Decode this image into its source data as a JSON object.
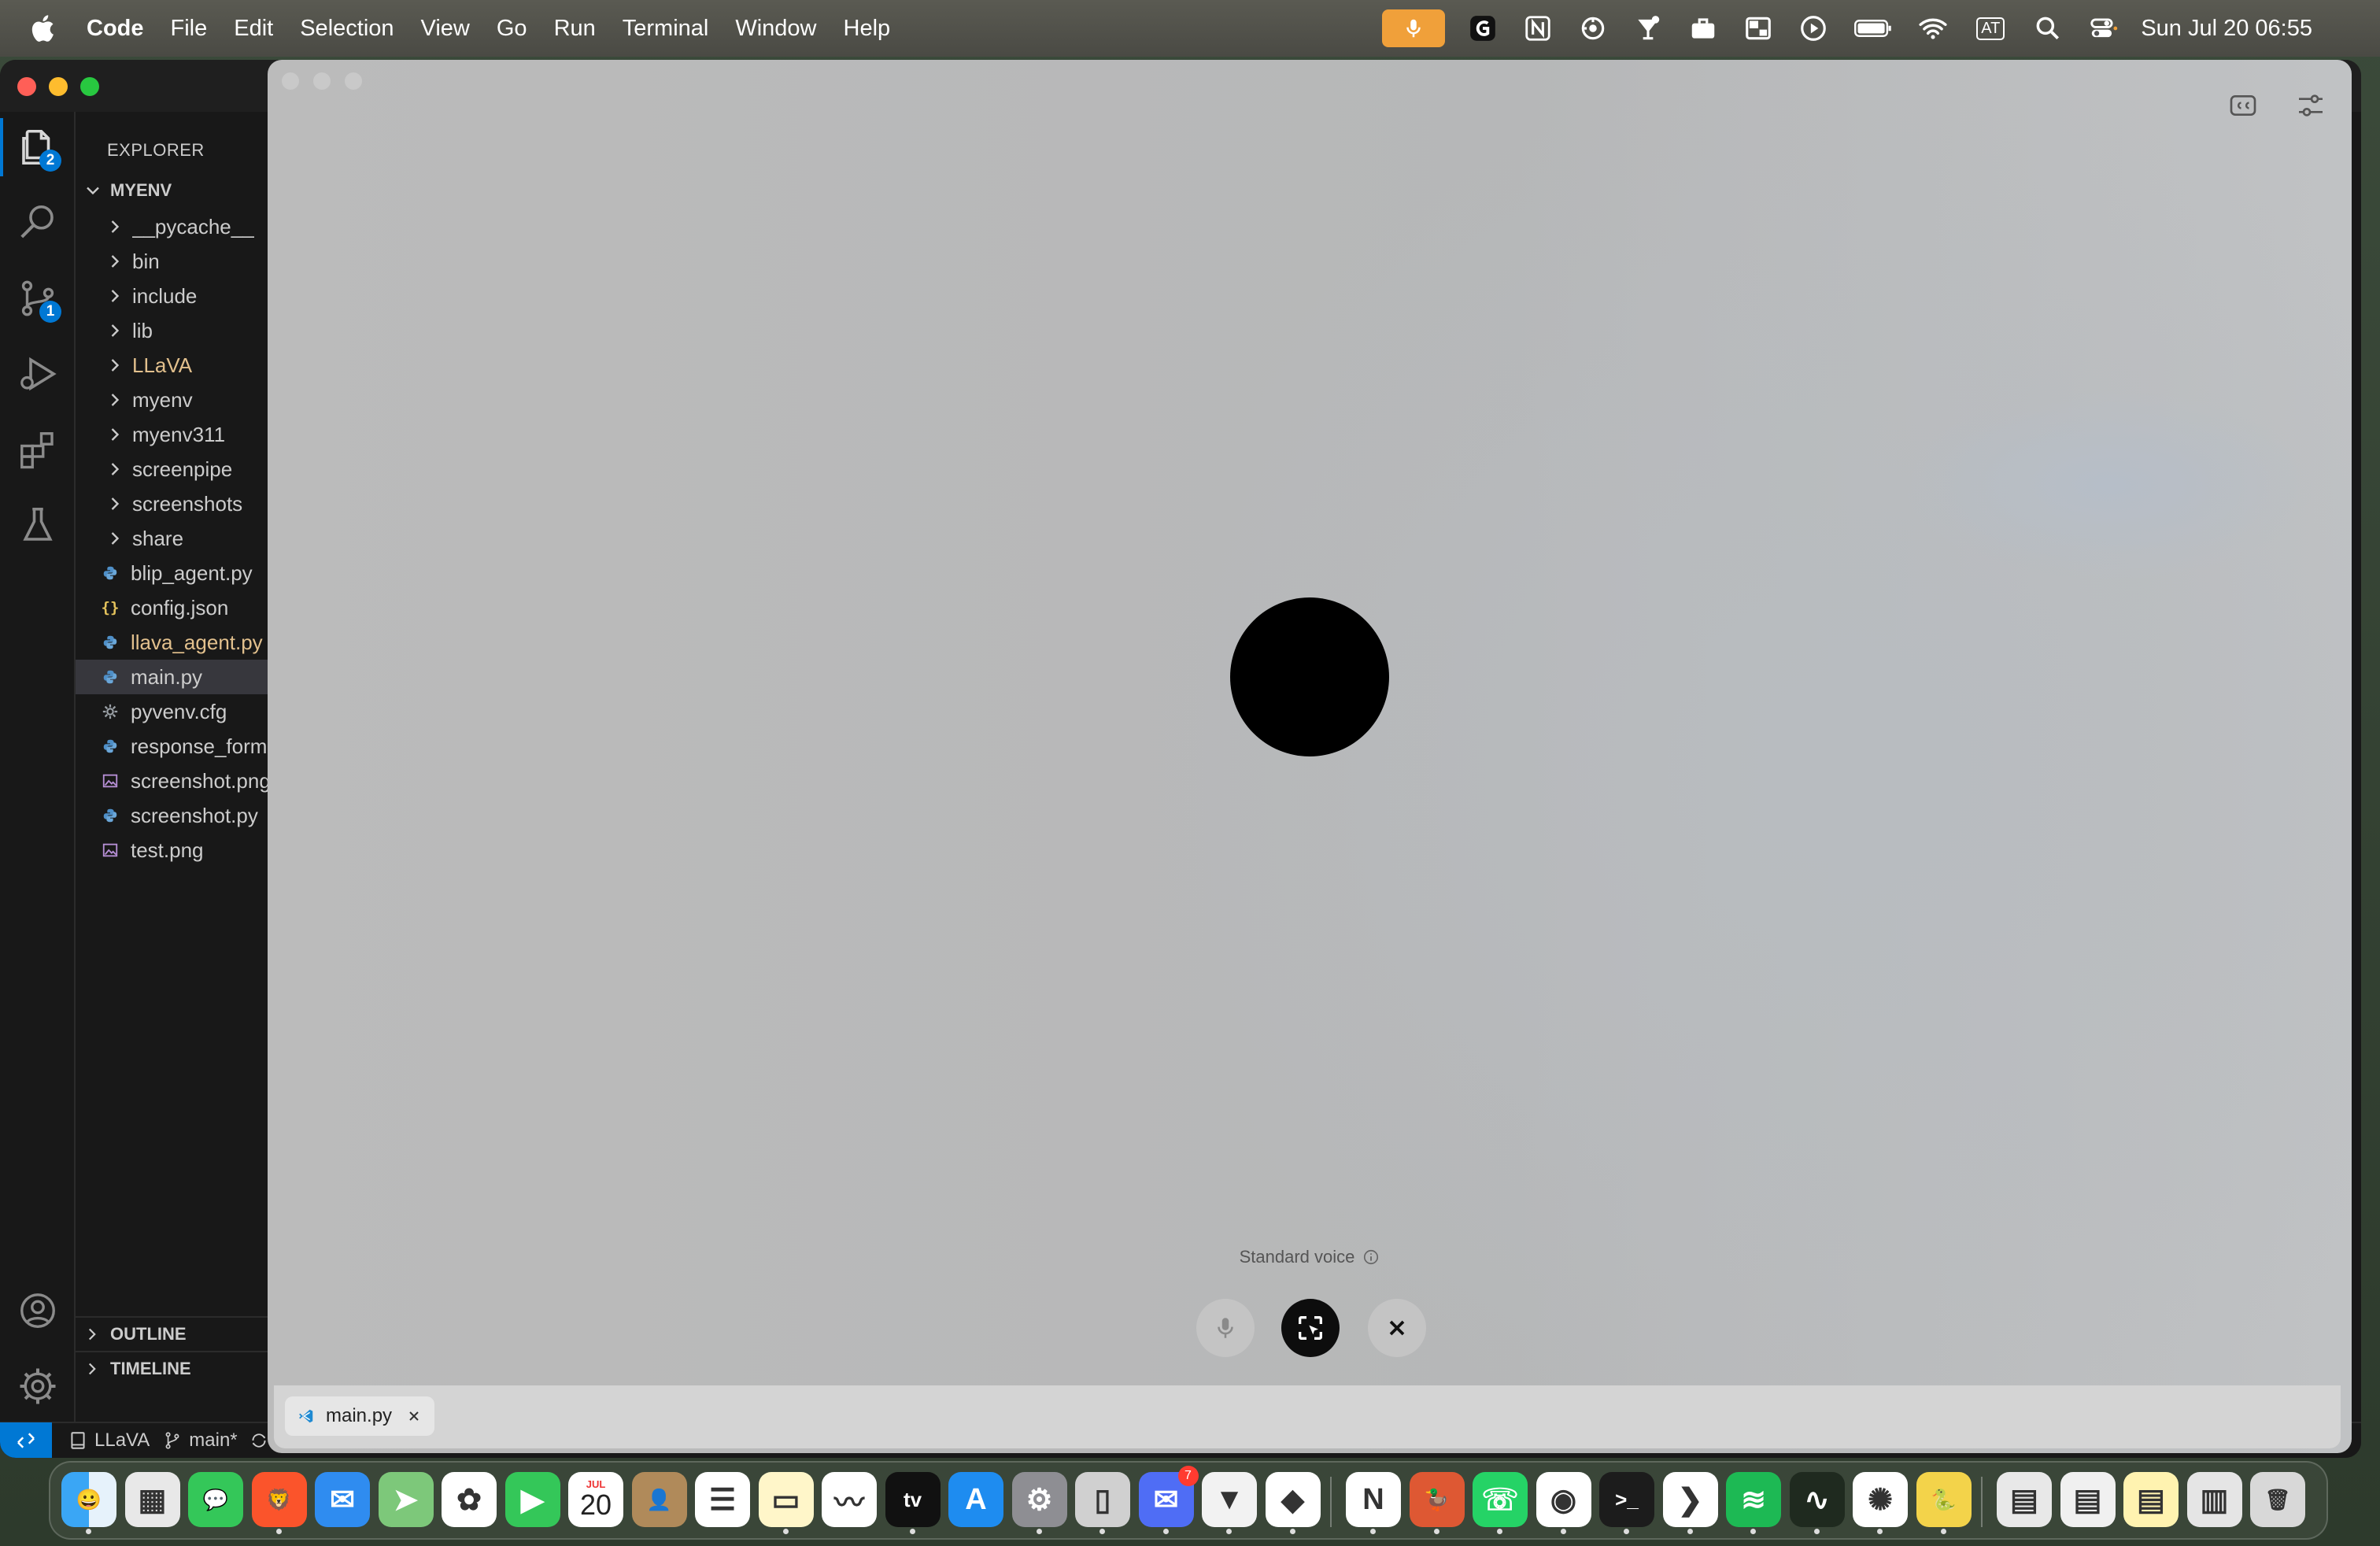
{
  "menubar": {
    "app_name": "Code",
    "menus": [
      "File",
      "Edit",
      "Selection",
      "View",
      "Go",
      "Run",
      "Terminal",
      "Window",
      "Help"
    ],
    "status_icons": [
      "mic-active-icon",
      "g-app-icon",
      "notion-menu-icon",
      "airbuddy-icon",
      "bartender-icon",
      "briefcase-icon",
      "window-manager-icon",
      "play-icon",
      "battery-icon",
      "wifi-icon",
      "keyboard-input-icon",
      "search-icon",
      "control-center-icon"
    ],
    "input_source": "AT",
    "clock": "Sun Jul 20  06:55",
    "mic_color": "#f0a03a"
  },
  "vscode": {
    "explorer_title": "EXPLORER",
    "root_folder": "MYENV",
    "activity": {
      "explorer_badge": "2",
      "scm_badge": "1"
    },
    "tree": [
      {
        "type": "folder",
        "label": "__pycache__"
      },
      {
        "type": "folder",
        "label": "bin"
      },
      {
        "type": "folder",
        "label": "include"
      },
      {
        "type": "folder",
        "label": "lib"
      },
      {
        "type": "folder",
        "label": "LLaVA",
        "modified": true
      },
      {
        "type": "folder",
        "label": "myenv"
      },
      {
        "type": "folder",
        "label": "myenv311"
      },
      {
        "type": "folder",
        "label": "screenpipe"
      },
      {
        "type": "folder",
        "label": "screenshots"
      },
      {
        "type": "folder",
        "label": "share"
      },
      {
        "type": "file",
        "icon": "python",
        "label": "blip_agent.py"
      },
      {
        "type": "file",
        "icon": "json",
        "label": "config.json"
      },
      {
        "type": "file",
        "icon": "python",
        "label": "llava_agent.py",
        "modified": true
      },
      {
        "type": "file",
        "icon": "python",
        "label": "main.py",
        "selected": true
      },
      {
        "type": "file",
        "icon": "gear",
        "label": "pyvenv.cfg"
      },
      {
        "type": "file",
        "icon": "python",
        "label": "response_form"
      },
      {
        "type": "file",
        "icon": "image",
        "label": "screenshot.png"
      },
      {
        "type": "file",
        "icon": "python",
        "label": "screenshot.py"
      },
      {
        "type": "file",
        "icon": "image",
        "label": "test.png"
      }
    ],
    "sections": [
      "OUTLINE",
      "TIMELINE"
    ],
    "status": {
      "folder": "LLaVA",
      "branch": "main*"
    },
    "accent": "#0078d4"
  },
  "voice_window": {
    "mode_label": "Standard voice",
    "tab_label": "main.py",
    "buttons": [
      "microphone",
      "share-screen",
      "close"
    ]
  },
  "dock": {
    "apps": [
      "Finder",
      "Launchpad",
      "Messages",
      "Brave Browser",
      "Mail",
      "Maps",
      "Photos",
      "FaceTime",
      "Calendar",
      "Contacts",
      "Reminders",
      "Notes",
      "Freeform",
      "Apple TV",
      "App Store",
      "System Settings",
      "iPhone Mirroring",
      "Spark Mail",
      "Linear",
      "Shortcuts",
      "Notion",
      "DuckDuckGo",
      "WhatsApp",
      "Google Chrome",
      "Terminal",
      "Visual Studio Code",
      "Spotify",
      "Activity Monitor",
      "ChatGPT",
      "Python Launcher",
      "Documents",
      "Files",
      "Notes Stack",
      "Downloads",
      "Trash"
    ],
    "calendar_month": "JUL",
    "calendar_day": "20",
    "mail_badge": "7"
  }
}
